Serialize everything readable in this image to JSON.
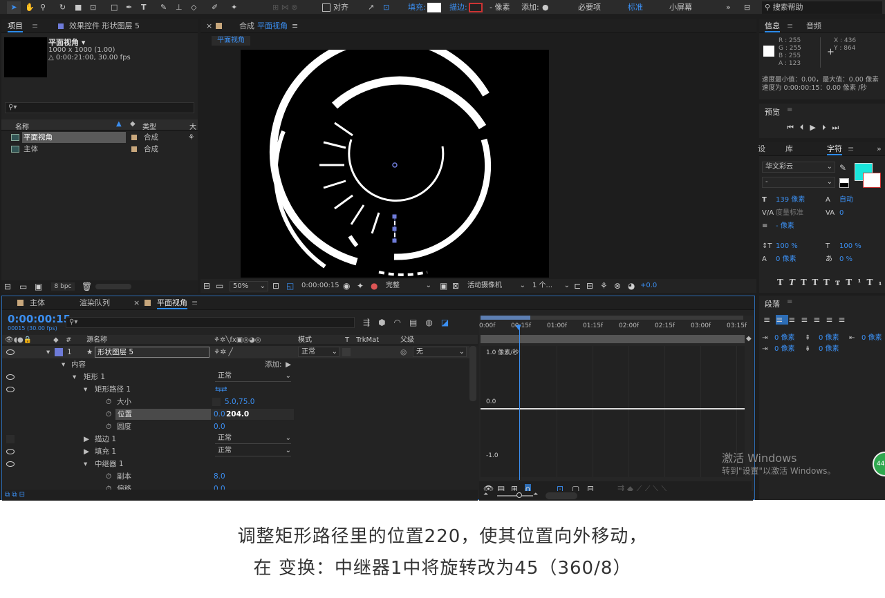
{
  "toolbar": {
    "snap": "对齐",
    "fill_label": "填充:",
    "stroke_label": "描边:",
    "stroke_unit": "- 像素",
    "add_label": "添加:",
    "workspaces": [
      "必要项",
      "标准",
      "小屏幕"
    ],
    "search_placeholder": "搜索帮助"
  },
  "project": {
    "tabs": [
      "项目",
      "效果控件 形状图层 5"
    ],
    "comp_name": "平面视角 ▾",
    "comp_size": "1000 x 1000 (1.00)",
    "comp_duration": "△ 0:00:21:00, 30.00 fps",
    "col_name": "名称",
    "col_type": "类型",
    "col_size": "大",
    "items": [
      {
        "name": "平面视角",
        "type": "合成"
      },
      {
        "name": "主体",
        "type": "合成"
      }
    ],
    "bpc": "8 bpc"
  },
  "viewer": {
    "tab": "合成",
    "tab_comp": "平面视角",
    "crumb": "平面视角",
    "zoom": "50%",
    "time": "0:00:00:15",
    "quality": "完整",
    "camera": "活动摄像机",
    "views": "1 个...",
    "exposure": "+0.0"
  },
  "info": {
    "tabs": [
      "信息",
      "音频"
    ],
    "r": "R : 255",
    "g": "G : 255",
    "b": "B : 255",
    "a": "A : 123",
    "x": "X : 436",
    "y": "Y : 864",
    "speed1": "速度最小值：0.00，最大值：0.00 像素",
    "speed2": "速度为 0:00:00:15：0.00 像素 /秒"
  },
  "preview": {
    "title": "预览"
  },
  "character": {
    "tabs": [
      "设",
      "库",
      "字符"
    ],
    "font": "华文彩云",
    "style": "-",
    "size": "139 像素",
    "leading": "自动",
    "kerning": "度量标准",
    "tracking": "0",
    "stroke_width": "- 像素",
    "vscale": "100 %",
    "hscale": "100 %",
    "baseline": "0 像素",
    "tsume": "0 %",
    "color": "#19e6dc"
  },
  "paragraph": {
    "title": "段落",
    "vals": [
      "0 像素",
      "0 像素",
      "0 像素",
      "0 像素",
      "0 像素"
    ]
  },
  "timeline": {
    "tabs": [
      "主体",
      "渲染队列",
      "平面视角"
    ],
    "timecode": "0:00:00:15",
    "frames": "00015 (30.00 fps)",
    "headers": {
      "src": "源名称",
      "mode": "模式",
      "t": "T",
      "trkmat": "TrkMat",
      "parent": "父级"
    },
    "ruler": [
      "0:00f",
      "00:15f",
      "01:00f",
      "01:15f",
      "02:00f",
      "02:15f",
      "03:00f",
      "03:15f"
    ],
    "graph_top": "1.0 像素/秒",
    "graph_mid": "0.0",
    "graph_bot": "-1.0",
    "layers": [
      {
        "num": "1",
        "name": "形状图层 5",
        "mode": "正常",
        "parent": "无"
      },
      {
        "label": "内容",
        "add": "添加:"
      },
      {
        "label": "矩形 1",
        "value": "正常"
      },
      {
        "label": "矩形路径 1"
      },
      {
        "label": "大小",
        "value": "5.0,75.0"
      },
      {
        "label": "位置",
        "value_a": "0.0",
        "value_b": "204.0"
      },
      {
        "label": "圆度",
        "value": "0.0"
      },
      {
        "label": "描边 1",
        "value": "正常"
      },
      {
        "label": "填充 1",
        "value": "正常"
      },
      {
        "label": "中继器 1"
      },
      {
        "label": "副本",
        "value": "8.0"
      },
      {
        "label": "偏移",
        "value": "0.0"
      }
    ]
  },
  "watermark": {
    "title": "激活 Windows",
    "sub": "转到\"设置\"以激活 Windows。"
  },
  "badge": "44",
  "caption": {
    "line1": "调整矩形路径里的位置220，使其位置向外移动，",
    "line2": "在 变换：中继器1中将旋转改为45（360/8）"
  }
}
